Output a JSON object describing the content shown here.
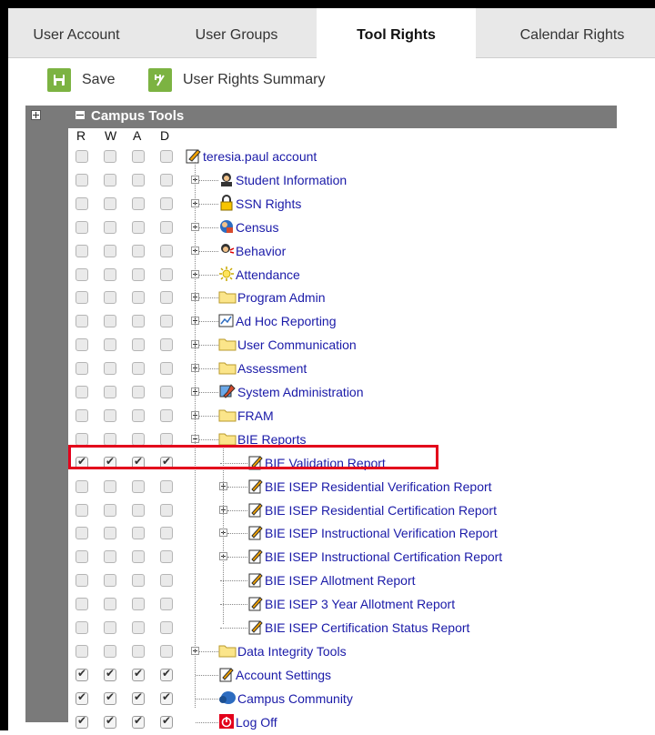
{
  "tabs": [
    {
      "label": "User Account",
      "active": false
    },
    {
      "label": "User Groups",
      "active": false
    },
    {
      "label": "Tool Rights",
      "active": true
    },
    {
      "label": "Calendar Rights",
      "active": false
    }
  ],
  "toolbar": {
    "save_label": "Save",
    "summary_label": "User Rights Summary"
  },
  "tree": {
    "header_title": "Campus Tools",
    "columns": [
      "R",
      "W",
      "A",
      "D"
    ],
    "root": {
      "label": "teresia.paul account",
      "icon": "account-icon"
    },
    "top_items": [
      {
        "label": "Student Information",
        "icon": "student-icon"
      },
      {
        "label": "SSN Rights",
        "icon": "lock-icon"
      },
      {
        "label": "Census",
        "icon": "census-icon"
      },
      {
        "label": "Behavior",
        "icon": "behavior-icon"
      },
      {
        "label": "Attendance",
        "icon": "attendance-icon"
      },
      {
        "label": "Program Admin",
        "icon": "folder-icon"
      },
      {
        "label": "Ad Hoc Reporting",
        "icon": "report-icon"
      },
      {
        "label": "User Communication",
        "icon": "folder-icon"
      },
      {
        "label": "Assessment",
        "icon": "folder-icon"
      },
      {
        "label": "System Administration",
        "icon": "wrench-icon"
      },
      {
        "label": "FRAM",
        "icon": "folder-icon"
      },
      {
        "label": "BIE Reports",
        "icon": "folder-icon"
      }
    ],
    "bie_items": [
      {
        "label": "BIE Validation Report",
        "checked": true,
        "expandable": false
      },
      {
        "label": "BIE ISEP Residential Verification Report",
        "checked": false,
        "expandable": true
      },
      {
        "label": "BIE ISEP Residential Certification Report",
        "checked": false,
        "expandable": true
      },
      {
        "label": "BIE ISEP Instructional Verification Report",
        "checked": false,
        "expandable": true
      },
      {
        "label": "BIE ISEP Instructional Certification Report",
        "checked": false,
        "expandable": true
      },
      {
        "label": "BIE ISEP Allotment Report",
        "checked": false,
        "expandable": false
      },
      {
        "label": "BIE ISEP 3 Year Allotment Report",
        "checked": false,
        "expandable": false
      },
      {
        "label": "BIE ISEP Certification Status Report",
        "checked": false,
        "expandable": false
      }
    ],
    "bottom_items": [
      {
        "label": "Data Integrity Tools",
        "icon": "folder-icon",
        "checked": false
      },
      {
        "label": "Account Settings",
        "icon": "settings-doc-icon",
        "checked": true
      },
      {
        "label": "Campus Community",
        "icon": "community-icon",
        "checked": true
      },
      {
        "label": "Log Off",
        "icon": "log-off-icon",
        "checked": true
      }
    ]
  },
  "colors": {
    "accent_green": "#7cb342",
    "header_gray": "#7a7a7a",
    "link_blue": "#1a1aa8",
    "highlight_red": "#e3001b"
  }
}
